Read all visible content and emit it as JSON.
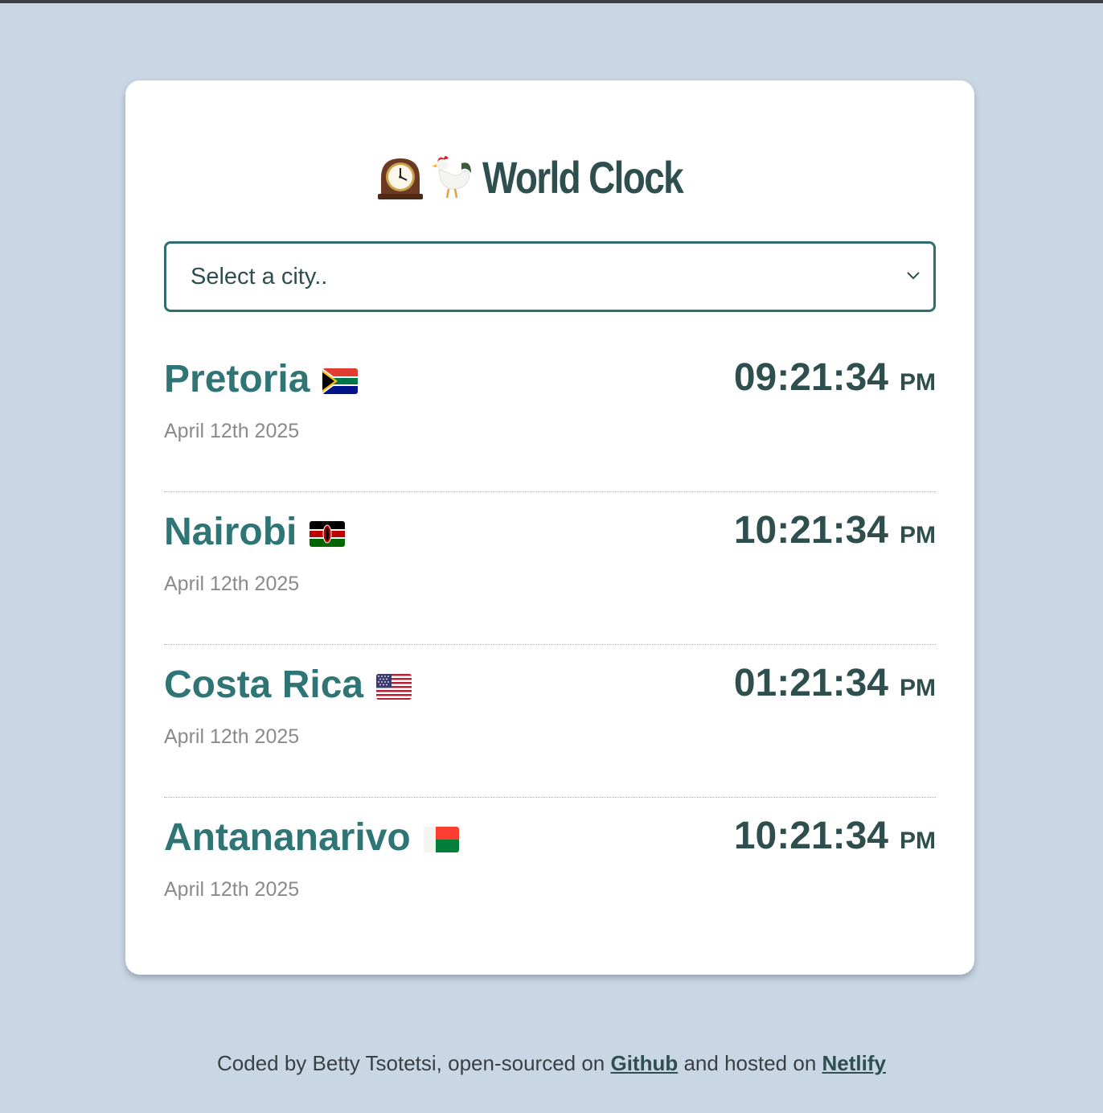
{
  "app": {
    "title": "World Clock",
    "title_icons": [
      "mantelpiece-clock-icon",
      "rooster-icon"
    ]
  },
  "city_select": {
    "selected_label": "Select a city..",
    "icon": "chevron-down-icon"
  },
  "cities": [
    {
      "name": "Pretoria",
      "flag": "south-africa-flag-icon",
      "date": "April 12th 2025",
      "time": "09:21:34",
      "ampm": "PM"
    },
    {
      "name": "Nairobi",
      "flag": "kenya-flag-icon",
      "date": "April 12th 2025",
      "time": "10:21:34",
      "ampm": "PM"
    },
    {
      "name": "Costa Rica",
      "flag": "usa-flag-icon",
      "date": "April 12th 2025",
      "time": "01:21:34",
      "ampm": "PM"
    },
    {
      "name": "Antananarivo",
      "flag": "madagascar-flag-icon",
      "date": "April 12th 2025",
      "time": "10:21:34",
      "ampm": "PM"
    }
  ],
  "footer": {
    "text_before": "Coded by Betty Tsotetsi, open-sourced on ",
    "github_label": "Github",
    "text_middle": " and hosted on ",
    "netlify_label": "Netlify"
  },
  "colors": {
    "background": "#c9d6e3",
    "card": "#ffffff",
    "city_name": "#2f7575",
    "time": "#2f4f4f",
    "date": "#8a8a8a",
    "select_border": "#2f6f6f"
  }
}
